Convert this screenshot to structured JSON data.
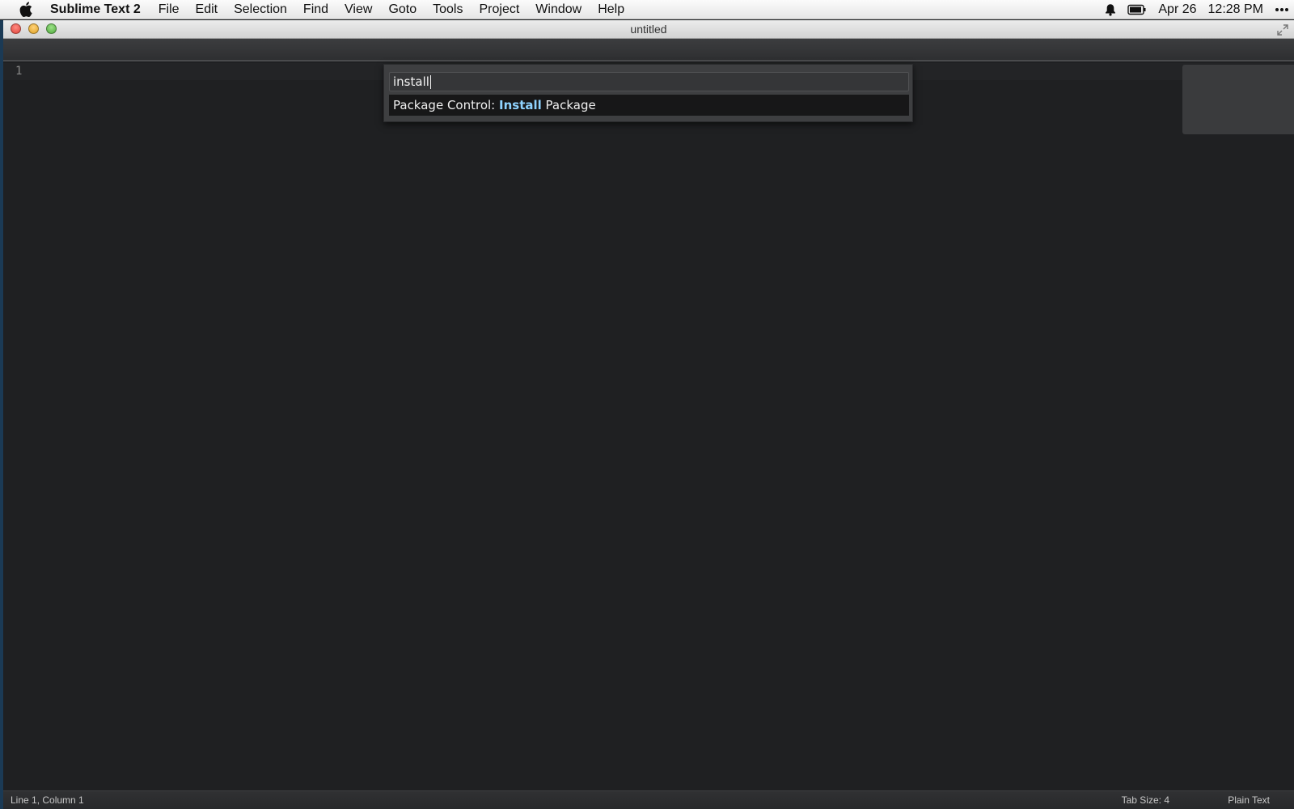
{
  "menubar": {
    "apple_icon": "apple-icon",
    "app_name": "Sublime Text 2",
    "items": [
      "File",
      "Edit",
      "Selection",
      "Find",
      "View",
      "Goto",
      "Tools",
      "Project",
      "Window",
      "Help"
    ],
    "date": "Apr 26",
    "time": "12:28 PM",
    "status_icons": [
      "notification-bell-icon",
      "battery-icon",
      "more-icon"
    ]
  },
  "window": {
    "title": "untitled"
  },
  "editor": {
    "line_numbers": [
      "1"
    ],
    "colors": {
      "background": "#1f2022",
      "gutter_text": "#8a8a8a"
    }
  },
  "command_palette": {
    "query": "install",
    "results": [
      {
        "prefix": "Package Control: ",
        "match": "Install",
        "suffix": " Package"
      }
    ],
    "colors": {
      "match_highlight": "#8fd3ff"
    }
  },
  "statusbar": {
    "position": "Line 1, Column 1",
    "tab_size": "Tab Size: 4",
    "syntax": "Plain Text"
  }
}
